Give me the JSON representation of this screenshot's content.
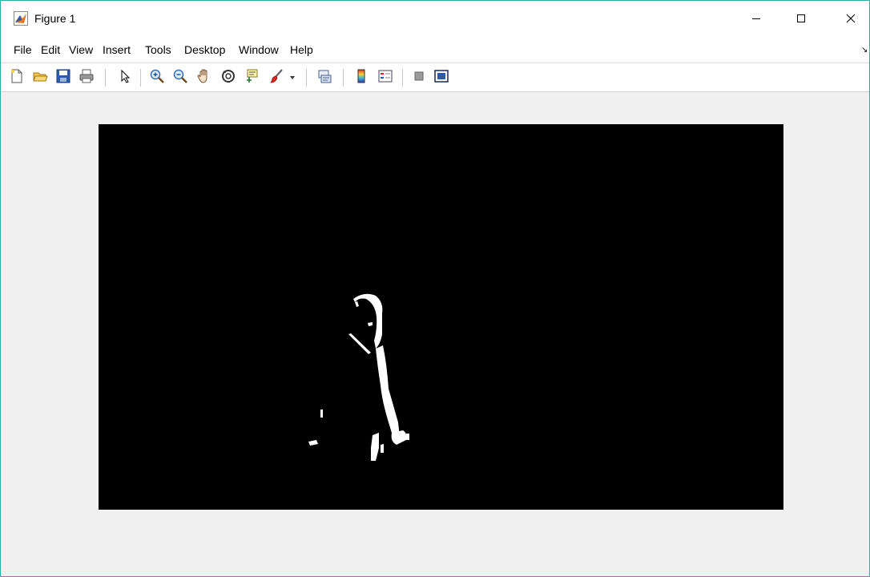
{
  "window": {
    "title": "Figure 1",
    "app_icon": "matlab-icon",
    "controls": {
      "minimize": "minimize-icon",
      "maximize": "maximize-icon",
      "close": "close-icon"
    },
    "border_color": "#3aa7a5"
  },
  "menu": {
    "items": [
      {
        "label": "File"
      },
      {
        "label": "Edit"
      },
      {
        "label": "View"
      },
      {
        "label": "Insert"
      },
      {
        "label": "Tools"
      },
      {
        "label": "Desktop"
      },
      {
        "label": "Window"
      },
      {
        "label": "Help"
      }
    ],
    "corner_arrow": "↘"
  },
  "toolbar": {
    "buttons": [
      {
        "icon": "new-figure-icon"
      },
      {
        "icon": "open-file-icon"
      },
      {
        "icon": "save-figure-icon"
      },
      {
        "icon": "print-figure-icon"
      },
      {
        "icon": "edit-plot-arrow-icon"
      },
      {
        "icon": "zoom-in-icon"
      },
      {
        "icon": "zoom-out-icon"
      },
      {
        "icon": "pan-hand-icon"
      },
      {
        "icon": "rotate-3d-icon"
      },
      {
        "icon": "data-cursor-icon"
      },
      {
        "icon": "brush-icon"
      },
      {
        "icon": "brush-dropdown-icon"
      },
      {
        "icon": "link-plot-icon"
      },
      {
        "icon": "insert-colorbar-icon"
      },
      {
        "icon": "insert-legend-icon"
      },
      {
        "icon": "hide-plot-tools-icon"
      },
      {
        "icon": "show-plot-tools-icon"
      }
    ]
  },
  "figure": {
    "background_color": "#f0f0f0",
    "image": {
      "type": "binary-mask",
      "background": "#000000",
      "foreground": "#ffffff"
    }
  }
}
